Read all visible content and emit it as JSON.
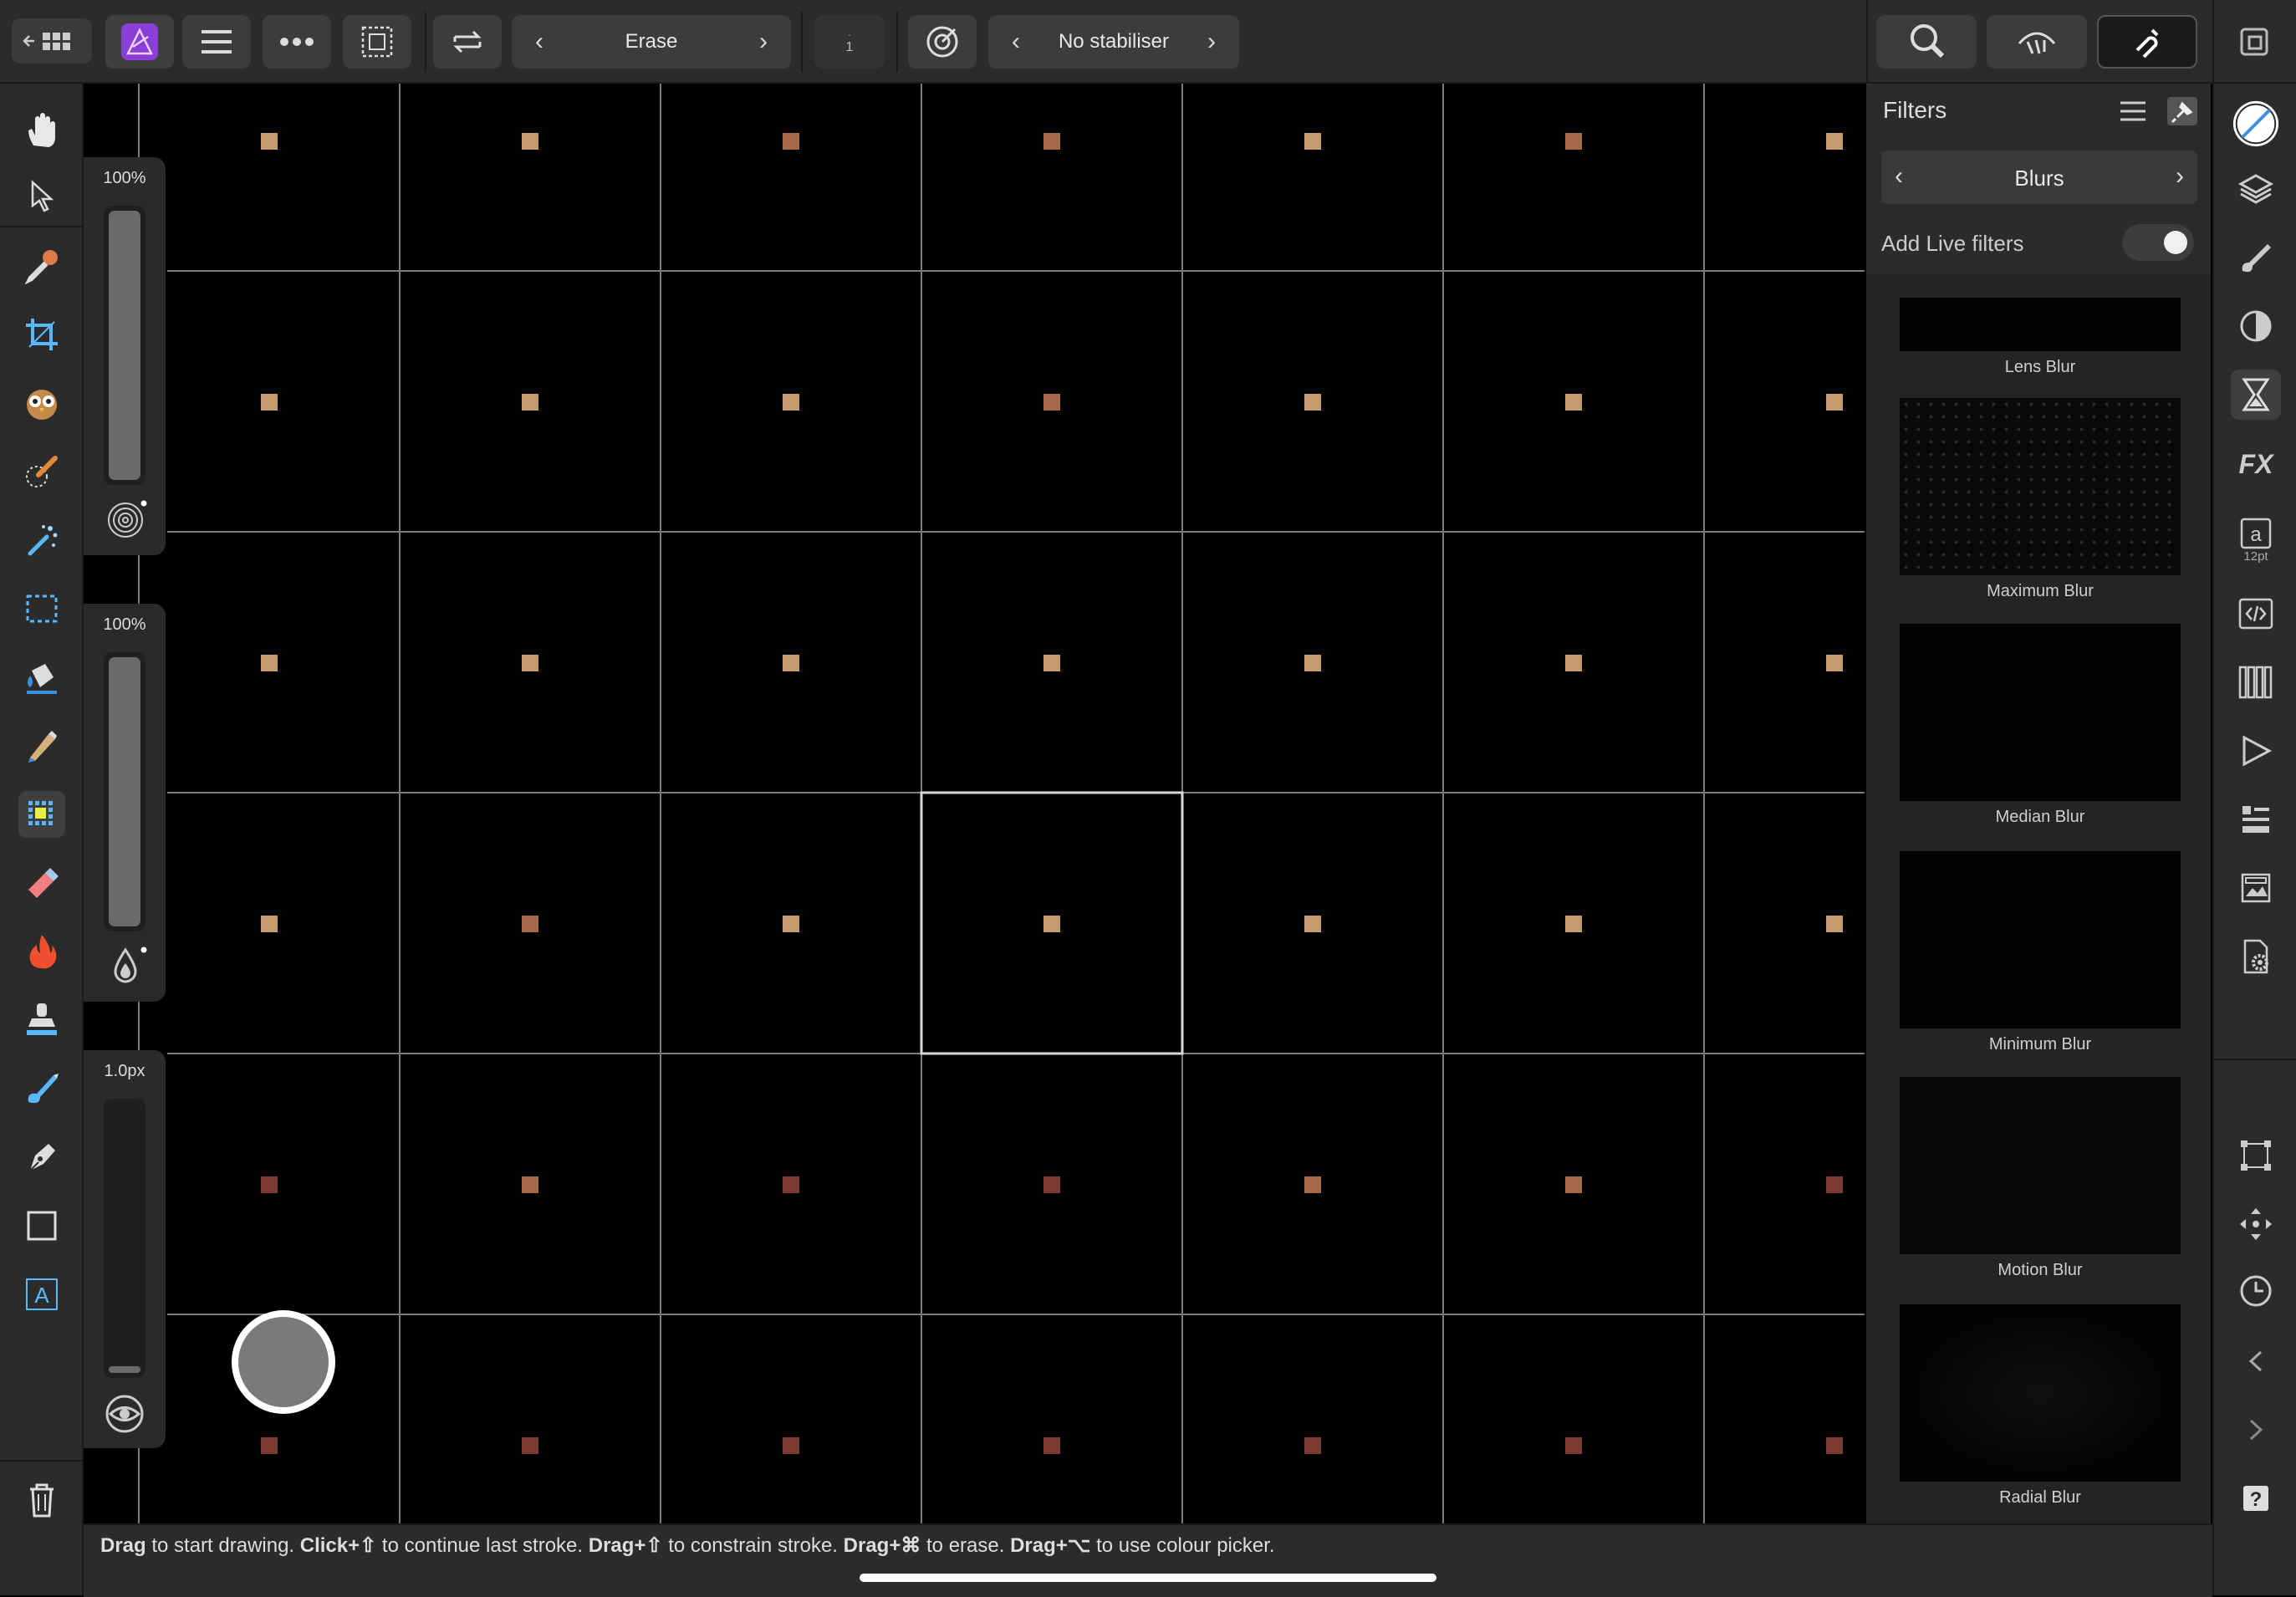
{
  "toolbar": {
    "brush_mode": "Erase",
    "stroke_count_dots": "·",
    "stroke_count": "1",
    "stabiliser": "No stabiliser"
  },
  "sliders": {
    "size_percent": "100%",
    "opacity_percent": "100%",
    "width_value": "1.0px",
    "size_level": 1.0,
    "opacity_level": 1.0,
    "width_level": 0.02
  },
  "filters_panel": {
    "title": "Filters",
    "category": "Blurs",
    "live_filters_label": "Add Live filters",
    "live_filters_on": false,
    "items": [
      "Lens Blur",
      "Maximum Blur",
      "Median Blur",
      "Minimum Blur",
      "Motion Blur",
      "Radial Blur"
    ]
  },
  "right_toolbar": {
    "character_size": "12pt"
  },
  "status": {
    "w1": "Drag",
    "t1": " to start drawing. ",
    "w2": "Click+⇧",
    "t2": " to continue last stroke. ",
    "w3": "Drag+⇧",
    "t3": " to constrain stroke. ",
    "w4": "Drag+⌘",
    "t4": " to erase. ",
    "w5": "Drag+⌥",
    "t5": " to use colour picker."
  },
  "colors": {
    "accent_purple": "#8b3fd9",
    "dot_light": "#c59a6d",
    "dot_mid": "#a8684a",
    "dot_dark": "#7d3a32",
    "grid_line": "#7a7a7a"
  },
  "icons": {
    "left_tools": [
      "hand-icon",
      "move-pointer-icon",
      "color-picker-icon",
      "crop-icon",
      "owl-icon",
      "selection-brush-icon",
      "magic-wand-icon",
      "marquee-icon",
      "flood-fill-icon",
      "paint-brush-icon",
      "pixel-brush-icon",
      "eraser-icon",
      "dodge-burn-icon",
      "clone-stamp-icon",
      "smudge-icon",
      "pen-icon",
      "rectangle-icon",
      "text-icon",
      "trash-icon"
    ],
    "right_tools": [
      "color-wheel-icon",
      "layers-icon",
      "brushes-icon",
      "adjustments-icon",
      "filters-icon",
      "fx-icon",
      "text-styles-icon",
      "macro-icon",
      "channels-icon",
      "play-icon",
      "navigator-icon",
      "export-icon",
      "settings-icon",
      "transform-icon",
      "move-icon",
      "history-icon",
      "collapse-left-icon",
      "expand-right-icon",
      "help-icon"
    ]
  }
}
